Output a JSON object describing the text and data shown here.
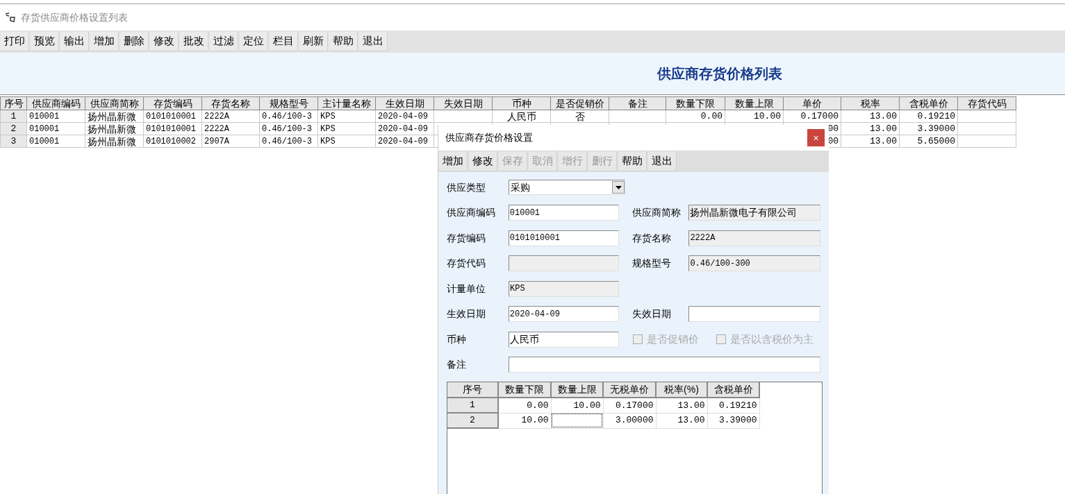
{
  "window": {
    "title": "存货供应商价格设置列表"
  },
  "toolbar": [
    "打印",
    "预览",
    "输出",
    "增加",
    "删除",
    "修改",
    "批改",
    "过滤",
    "定位",
    "栏目",
    "刷新",
    "帮助",
    "退出"
  ],
  "report_title": "供应商存货价格列表",
  "table": {
    "columns": [
      "序号",
      "供应商编码",
      "供应商简称",
      "存货编码",
      "存货名称",
      "规格型号",
      "主计量名称",
      "生效日期",
      "失效日期",
      "币种",
      "是否促销价",
      "备注",
      "数量下限",
      "数量上限",
      "单价",
      "税率",
      "含税单价",
      "存货代码"
    ],
    "rows": [
      {
        "cells": [
          "1",
          "010001",
          "扬州晶新微",
          "0101010001",
          "2222A",
          "0.46/100-3",
          "KPS",
          "2020-04-09",
          null,
          "人民币",
          "否",
          null,
          "0.00",
          "10.00",
          "0.17000",
          "13.00",
          "0.19210",
          null
        ]
      },
      {
        "cells": [
          "2",
          "010001",
          "扬州晶新微",
          "0101010001",
          "2222A",
          "0.46/100-3",
          "KPS",
          "2020-04-09",
          null,
          null,
          null,
          null,
          null,
          null,
          "00",
          "13.00",
          "3.39000",
          null
        ]
      },
      {
        "cells": [
          "3",
          "010001",
          "扬州晶新微",
          "0101010002",
          "2907A",
          "0.46/100-3",
          "KPS",
          "2020-04-09",
          null,
          null,
          null,
          null,
          null,
          null,
          "00",
          "13.00",
          "5.65000",
          null
        ]
      }
    ]
  },
  "dialog": {
    "title": "供应商存货价格设置",
    "close": "×",
    "toolbar": [
      {
        "label": "增加",
        "disabled": false
      },
      {
        "label": "修改",
        "disabled": false
      },
      {
        "label": "保存",
        "disabled": true
      },
      {
        "label": "取消",
        "disabled": true
      },
      {
        "label": "增行",
        "disabled": true
      },
      {
        "label": "删行",
        "disabled": true
      },
      {
        "label": "帮助",
        "disabled": false
      },
      {
        "label": "退出",
        "disabled": false
      }
    ],
    "form": [
      {
        "items": [
          {
            "kind": "select",
            "label": "供应类型",
            "value": "采购"
          }
        ]
      },
      {
        "items": [
          {
            "kind": "input",
            "label": "供应商编码",
            "value": "010001"
          },
          {
            "kind": "readonly",
            "label": "供应商简称",
            "value": "扬州晶新微电子有限公司"
          }
        ]
      },
      {
        "items": [
          {
            "kind": "input",
            "label": "存货编码",
            "value": "0101010001"
          },
          {
            "kind": "readonly",
            "label": "存货名称",
            "value": "2222A"
          }
        ]
      },
      {
        "items": [
          {
            "kind": "readonly",
            "label": "存货代码"
          },
          {
            "kind": "readonly",
            "label": "规格型号",
            "value": "0.46/100-300"
          }
        ]
      },
      {
        "items": [
          {
            "kind": "readonly",
            "label": "计量单位",
            "value": "KPS"
          }
        ]
      },
      {
        "items": [
          {
            "kind": "input",
            "label": "生效日期",
            "value": "2020-04-09"
          },
          {
            "kind": "input",
            "label": "失效日期"
          }
        ]
      },
      {
        "items": [
          {
            "kind": "input",
            "label": "币种",
            "value": "人民币"
          },
          {
            "kind": "checkbox",
            "label": "是否促销价",
            "checked": false,
            "disabled": true
          },
          {
            "kind": "checkbox",
            "label": "是否以含税价为主",
            "checked": false,
            "disabled": true
          }
        ]
      },
      {
        "items": [
          {
            "kind": "wide",
            "label": "备注"
          }
        ]
      }
    ],
    "grid": {
      "columns": [
        "序号",
        "数量下限",
        "数量上限",
        "无税单价",
        "税率(%)",
        "含税单价"
      ],
      "rows": [
        {
          "cells": [
            {
              "text": "1",
              "focused": false
            },
            {
              "text": "0.00",
              "focused": false
            },
            {
              "text": "10.00",
              "focused": false
            },
            {
              "text": "0.17000",
              "focused": false
            },
            {
              "text": "13.00",
              "focused": false
            },
            {
              "text": "0.19210",
              "focused": false
            }
          ]
        },
        {
          "cells": [
            {
              "text": "2",
              "focused": false
            },
            {
              "text": "10.00",
              "focused": false
            },
            {
              "focused": true
            },
            {
              "text": "3.00000",
              "focused": false
            },
            {
              "text": "13.00",
              "focused": false
            },
            {
              "text": "3.39000",
              "focused": false
            }
          ]
        }
      ]
    }
  }
}
